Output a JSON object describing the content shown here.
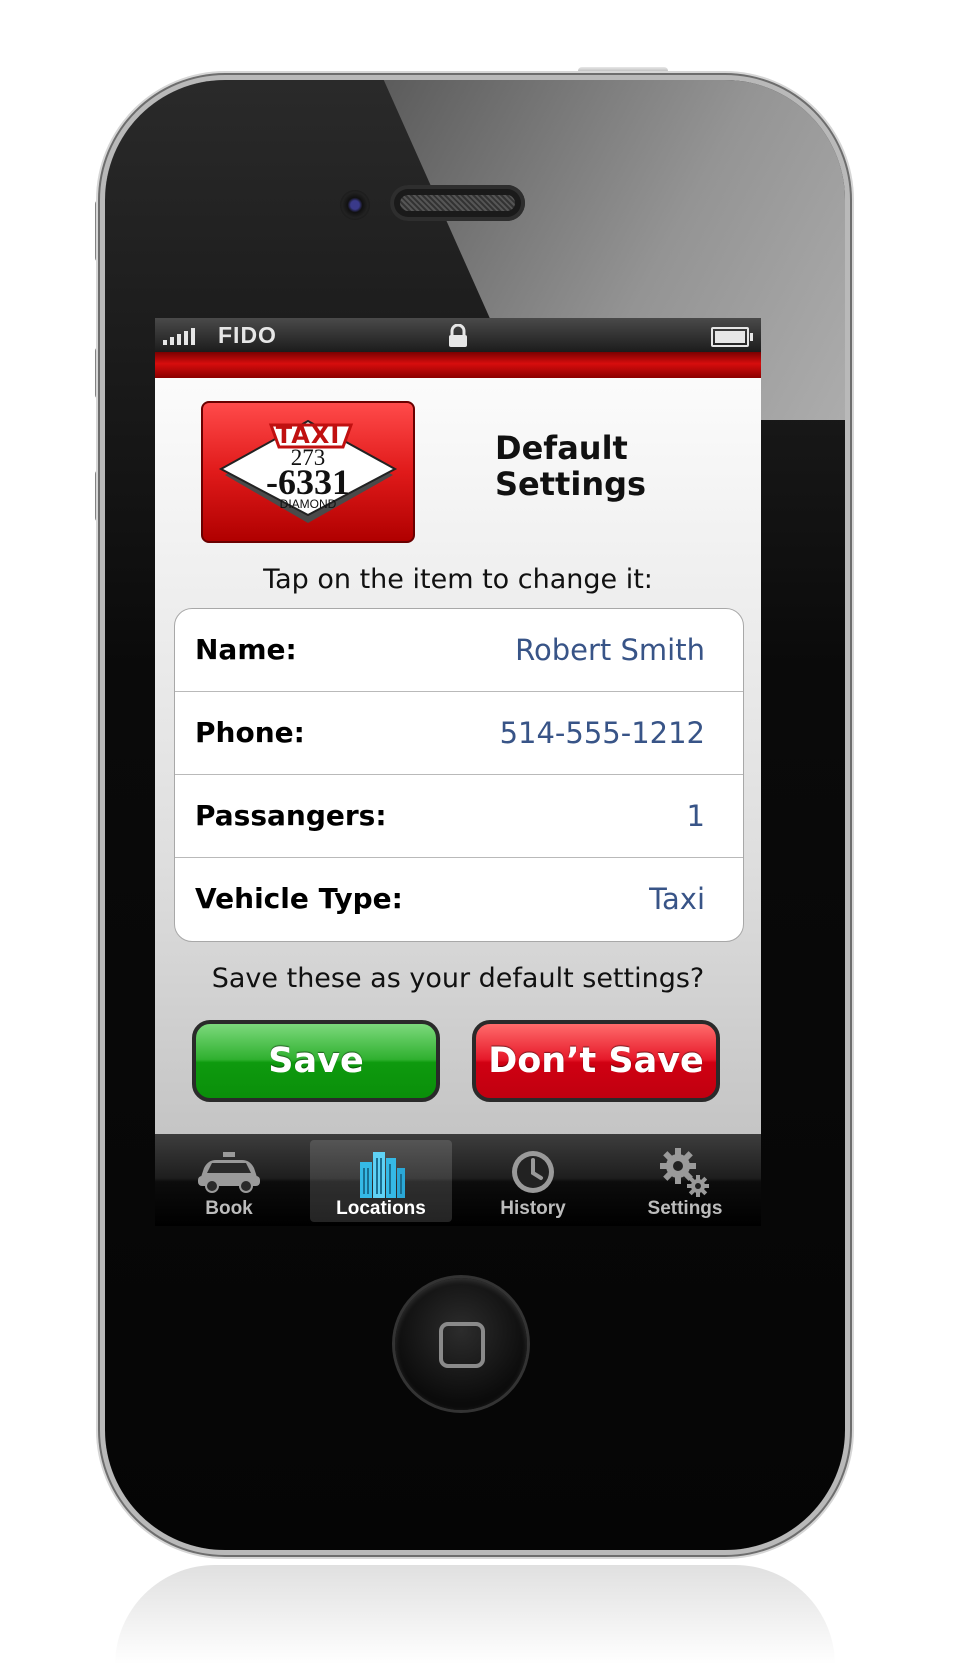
{
  "status_bar": {
    "carrier": "FIDO",
    "icons": [
      "signal-bars-icon",
      "lock-icon",
      "battery-icon"
    ]
  },
  "header": {
    "logo": {
      "top_text": "TAXI",
      "number_line1": "273",
      "number_line2": "-6331",
      "bottom_text": "DIAMOND"
    },
    "title_line1": "Default",
    "title_line2": "Settings"
  },
  "instructions": "Tap on the item to change it:",
  "settings": [
    {
      "label": "Name:",
      "value": "Robert Smith"
    },
    {
      "label": "Phone:",
      "value": "514-555-1212"
    },
    {
      "label": "Passangers:",
      "value": "1"
    },
    {
      "label": "Vehicle Type:",
      "value": "Taxi"
    }
  ],
  "save_prompt": "Save these as your default settings?",
  "buttons": {
    "save": "Save",
    "dont_save": "Don’t Save"
  },
  "tabs": [
    {
      "label": "Book",
      "icon": "car-icon",
      "active": false
    },
    {
      "label": "Locations",
      "icon": "buildings-icon",
      "active": true
    },
    {
      "label": "History",
      "icon": "clock-icon",
      "active": false
    },
    {
      "label": "Settings",
      "icon": "gears-icon",
      "active": false
    }
  ],
  "colors": {
    "accent_red": "#d70d0d",
    "save_green": "#0e9a0e",
    "dont_save_red": "#d00012",
    "value_blue": "#385487"
  }
}
